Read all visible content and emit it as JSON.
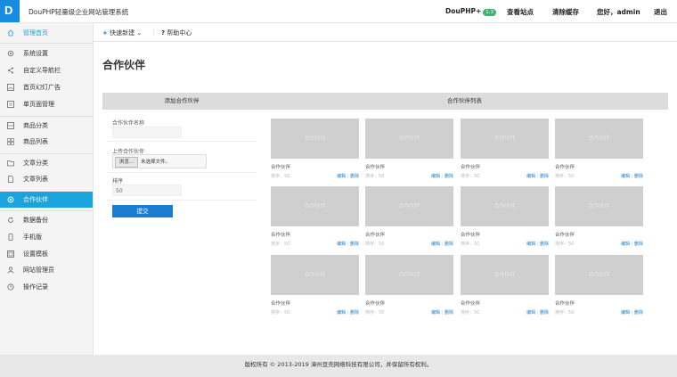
{
  "app": {
    "title": "DouPHP轻量级企业网站管理系统"
  },
  "topnav": {
    "brand": "DouPHP+",
    "badge": "1.3",
    "view_site": "查看站点",
    "clear_cache": "清除缓存",
    "greeting": "您好，admin",
    "logout": "退出"
  },
  "subbar": {
    "quick_create": "快速新建",
    "help": "帮助中心"
  },
  "sidebar": {
    "items": [
      {
        "label": "管理首页",
        "icon": "home-icon"
      },
      {
        "label": "系统设置",
        "icon": "gear-icon"
      },
      {
        "label": "自定义导航栏",
        "icon": "share-icon"
      },
      {
        "label": "首页幻灯广告",
        "icon": "image-icon"
      },
      {
        "label": "单页面管理",
        "icon": "page-icon"
      },
      {
        "label": "商品分类",
        "icon": "grid-icon"
      },
      {
        "label": "商品列表",
        "icon": "list-icon"
      },
      {
        "label": "文章分类",
        "icon": "folder-icon"
      },
      {
        "label": "文章列表",
        "icon": "document-icon"
      },
      {
        "label": "合作伙伴",
        "icon": "link-icon"
      },
      {
        "label": "数据备份",
        "icon": "refresh-icon"
      },
      {
        "label": "手机版",
        "icon": "mobile-icon"
      },
      {
        "label": "设置模板",
        "icon": "template-icon"
      },
      {
        "label": "网站管理员",
        "icon": "user-icon"
      },
      {
        "label": "操作记录",
        "icon": "clock-icon"
      }
    ]
  },
  "page": {
    "title": "合作伙伴",
    "add_header": "添加合作伙伴",
    "list_header": "合作伙伴列表"
  },
  "form": {
    "name_label": "合作伙伴名称",
    "name_value": "",
    "upload_label": "上传合作伙伴",
    "browse": "浏览...",
    "no_file": "未选择文件。",
    "sort_label": "排序",
    "sort_value": "50",
    "submit": "提交"
  },
  "partners": [
    {
      "image_text": "合作伙伴",
      "name": "合作伙伴",
      "sort": "排序：50"
    },
    {
      "image_text": "合作伙伴",
      "name": "合作伙伴",
      "sort": "排序：50"
    },
    {
      "image_text": "合作伙伴",
      "name": "合作伙伴",
      "sort": "排序：50"
    },
    {
      "image_text": "合作伙伴",
      "name": "合作伙伴",
      "sort": "排序：50"
    },
    {
      "image_text": "合作伙伴",
      "name": "合作伙伴",
      "sort": "排序：50"
    },
    {
      "image_text": "合作伙伴",
      "name": "合作伙伴",
      "sort": "排序：50"
    },
    {
      "image_text": "合作伙伴",
      "name": "合作伙伴",
      "sort": "排序：50"
    },
    {
      "image_text": "合作伙伴",
      "name": "合作伙伴",
      "sort": "排序：50"
    },
    {
      "image_text": "合作伙伴",
      "name": "合作伙伴",
      "sort": "排序：50"
    },
    {
      "image_text": "合作伙伴",
      "name": "合作伙伴",
      "sort": "排序：50"
    },
    {
      "image_text": "合作伙伴",
      "name": "合作伙伴",
      "sort": "排序：50"
    },
    {
      "image_text": "合作伙伴",
      "name": "合作伙伴",
      "sort": "排序：50"
    }
  ],
  "card_actions": {
    "edit": "编辑",
    "delete": "删除"
  },
  "footer": "版权所有 © 2013-2019 漳州豆壳网络科技有限公司，并保留所有权利。"
}
